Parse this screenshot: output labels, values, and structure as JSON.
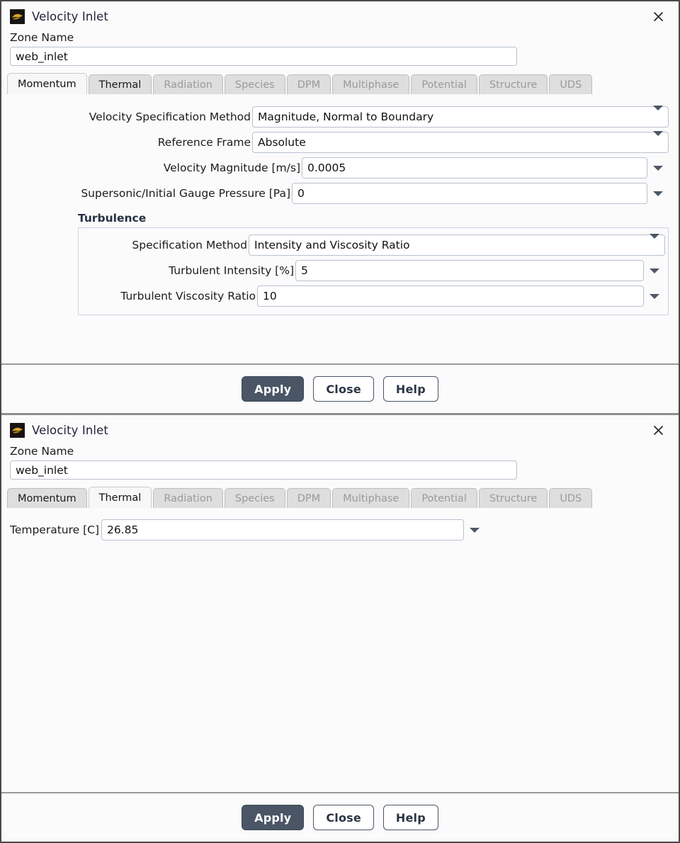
{
  "window": {
    "title": "Velocity Inlet",
    "icon": "fluent-logo-icon",
    "close_icon": "close-icon"
  },
  "zone": {
    "label": "Zone Name",
    "value": "web_inlet"
  },
  "tabs": [
    {
      "label": "Momentum",
      "state": "active"
    },
    {
      "label": "Thermal",
      "state": "enabled"
    },
    {
      "label": "Radiation",
      "state": "disabled"
    },
    {
      "label": "Species",
      "state": "disabled"
    },
    {
      "label": "DPM",
      "state": "disabled"
    },
    {
      "label": "Multiphase",
      "state": "disabled"
    },
    {
      "label": "Potential",
      "state": "disabled"
    },
    {
      "label": "Structure",
      "state": "disabled"
    },
    {
      "label": "UDS",
      "state": "disabled"
    }
  ],
  "momentum": {
    "velocity_spec_method": {
      "label": "Velocity Specification Method",
      "value": "Magnitude, Normal to Boundary"
    },
    "reference_frame": {
      "label": "Reference Frame",
      "value": "Absolute"
    },
    "velocity_magnitude": {
      "label": "Velocity Magnitude [m/s]",
      "value": "0.0005"
    },
    "supersonic_gauge_pressure": {
      "label": "Supersonic/Initial Gauge Pressure [Pa]",
      "value": "0"
    },
    "turbulence": {
      "title": "Turbulence",
      "spec_method": {
        "label": "Specification Method",
        "value": "Intensity and Viscosity Ratio"
      },
      "intensity": {
        "label": "Turbulent Intensity [%]",
        "value": "5"
      },
      "viscosity_ratio": {
        "label": "Turbulent Viscosity Ratio",
        "value": "10"
      }
    }
  },
  "thermal": {
    "temperature": {
      "label": "Temperature [C]",
      "value": "26.85"
    }
  },
  "buttons": {
    "apply": "Apply",
    "close": "Close",
    "help": "Help"
  },
  "colors": {
    "primary_button": "#4a5566",
    "field_border": "#b9c2cf",
    "group_heading": "#253040",
    "icon_gold": "#d9a328"
  }
}
